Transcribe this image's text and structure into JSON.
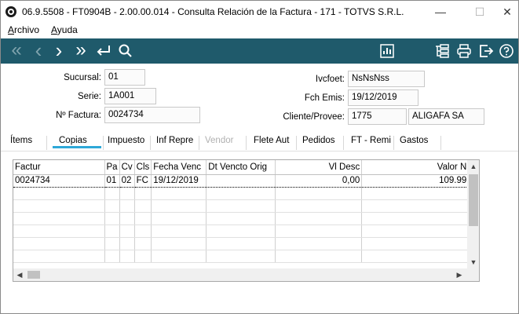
{
  "window": {
    "title": "06.9.5508 - FT0904B - 2.00.00.014 - Consulta Relación de la Factura - 171 - TOTVS S.R.L.",
    "minimize": "—",
    "maximize": "☐",
    "close": "✕"
  },
  "menu": {
    "archivo": "Archivo",
    "ayuda": "Ayuda"
  },
  "toolbar": {
    "first": "«",
    "prev": "‹",
    "next": "›",
    "last": "»",
    "color": "#1f5a6b"
  },
  "form": {
    "sucursal_label": "Sucursal:",
    "sucursal_value": "01",
    "serie_label": "Serie:",
    "serie_value": "1A001",
    "nfactura_label": "Nº Factura:",
    "nfactura_value": "0024734",
    "ivcfoet_label": "Ivcfoet:",
    "ivcfoet_value": "NsNsNss",
    "fchemis_label": "Fch Emis:",
    "fchemis_value": "19/12/2019",
    "cliente_label": "Cliente/Provee:",
    "cliente_code": "1775",
    "cliente_name": "ALIGAFA SA"
  },
  "tabs": [
    "Ítems",
    "Copias",
    "Impuesto",
    "Inf Repre",
    "Vendor",
    "Flete Aut",
    "Pedidos",
    "FT - Remi",
    "Gastos"
  ],
  "grid": {
    "columns": [
      "Factur",
      "Pa",
      "Cv",
      "Cls",
      "Fecha Venc",
      "Dt Vencto Orig",
      "Vl Desc",
      "Valor N"
    ],
    "rows": [
      [
        "0024734",
        "01",
        "02",
        "FC",
        "19/12/2019",
        "",
        "0,00",
        "109.99"
      ]
    ]
  }
}
